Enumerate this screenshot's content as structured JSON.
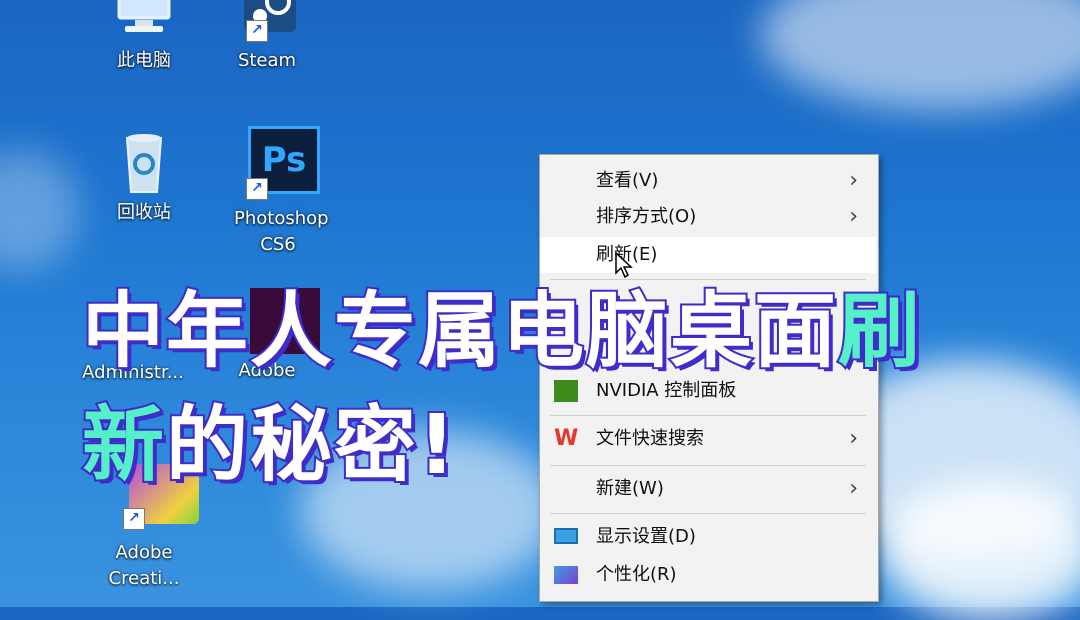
{
  "desktop": {
    "icons": [
      {
        "label": "此电脑",
        "icon": "this-pc-icon"
      },
      {
        "label": "Steam",
        "icon": "steam-icon"
      },
      {
        "label": "回收站",
        "icon": "recycle-bin-icon"
      },
      {
        "label": "Photoshop CS6",
        "icon": "photoshop-icon",
        "line1": "Photoshop",
        "line2": "CS6",
        "badge": "Ps"
      },
      {
        "label": "Administr...",
        "icon": "administrator-folder-icon"
      },
      {
        "label": "Adobe",
        "icon": "adobe-app-icon"
      },
      {
        "label": "Adobe Creati...",
        "icon": "adobe-creative-cloud-icon",
        "line1": "Adobe",
        "line2": "Creati..."
      }
    ]
  },
  "context_menu": {
    "items": [
      {
        "label": "查看(V)",
        "submenu": true
      },
      {
        "label": "排序方式(O)",
        "submenu": true
      },
      {
        "label": "刷新(E)",
        "submenu": false,
        "hovered": true
      },
      {
        "label": "NVIDIA 控制面板",
        "submenu": false,
        "icon": "nvidia-icon"
      },
      {
        "label": "文件快速搜索",
        "submenu": true,
        "icon": "wps-icon",
        "icon_text": "W"
      },
      {
        "label": "新建(W)",
        "submenu": true
      },
      {
        "label": "显示设置(D)",
        "submenu": false,
        "icon": "display-icon"
      },
      {
        "label": "个性化(R)",
        "submenu": false,
        "icon": "personalize-icon"
      }
    ],
    "submenu_arrow": "›"
  },
  "headline": {
    "line1_main": "中年人专属电脑桌面",
    "line1_accent": "刷",
    "line2_accent": "新",
    "line2_main": "的秘密!"
  },
  "colors": {
    "sky": "#1e76d0",
    "menu_bg": "#f2f2f2",
    "headline_fill": "#ffffff",
    "headline_stroke": "#3f2cc9",
    "headline_accent": "#55f0c8",
    "photoshop_bg": "#0b1f3d",
    "photoshop_text": "#31a8ff",
    "wps_red": "#e5382b"
  }
}
